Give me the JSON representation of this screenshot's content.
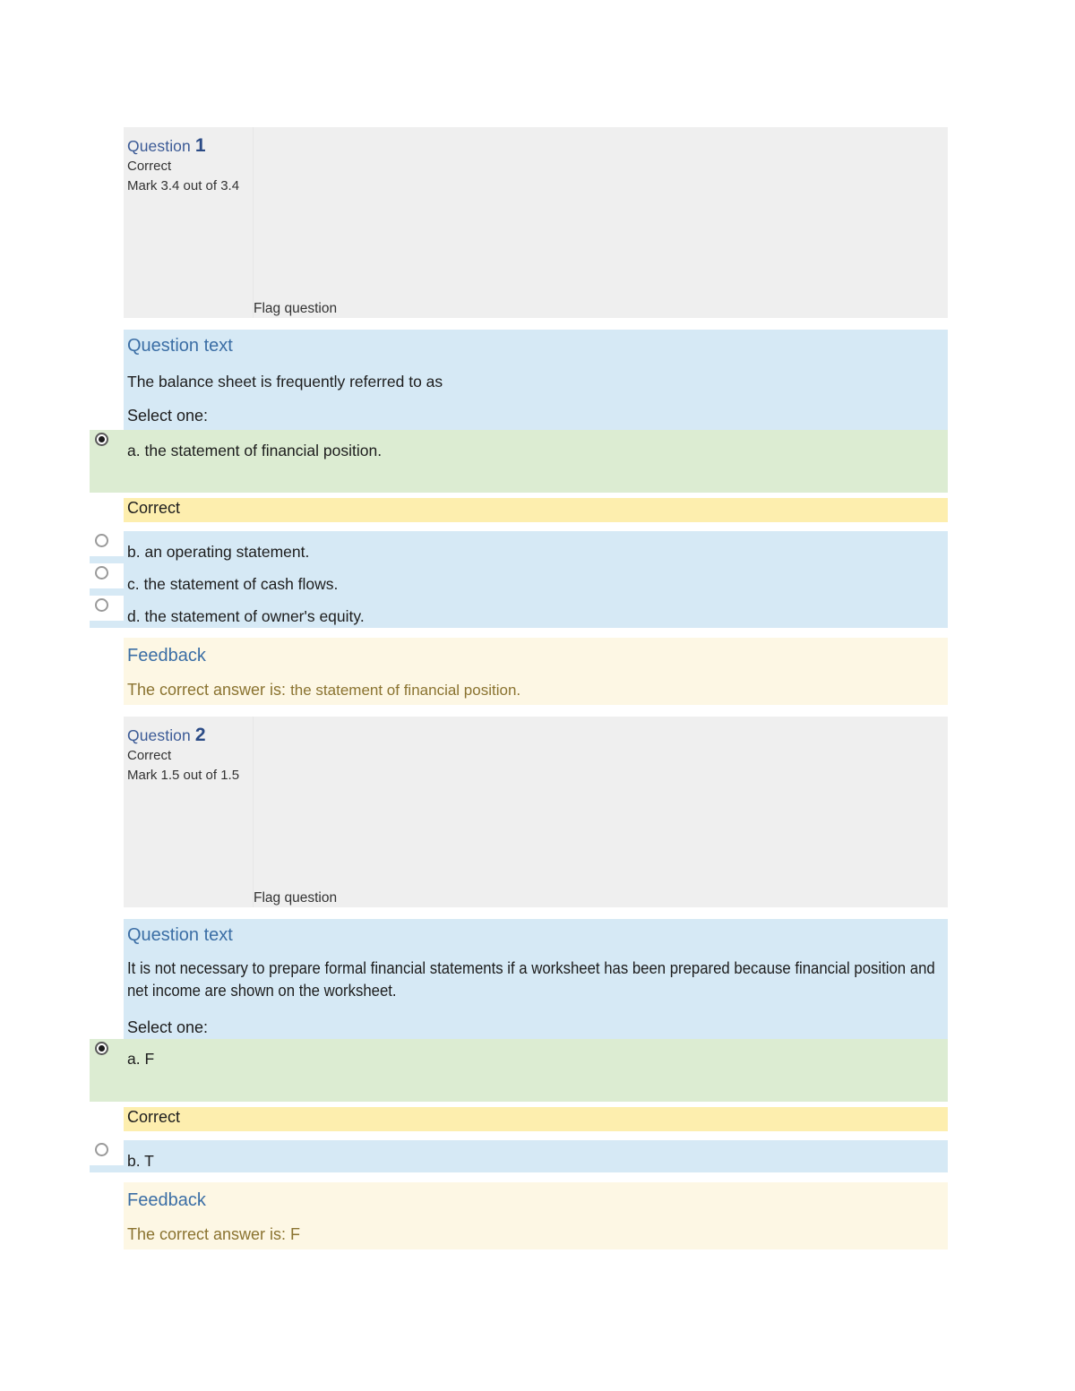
{
  "colors": {
    "header_bg": "#efefef",
    "question_bg": "#d6e9f5",
    "correct_option_bg": "#dcecd2",
    "correct_band_bg": "#fdeeae",
    "feedback_bg": "#fdf7e4",
    "heading_blue": "#3b6ea5",
    "feedback_text": "#8a7330"
  },
  "questions": [
    {
      "number_label": "Question",
      "number": "1",
      "state": "Correct",
      "mark": "Mark 3.4 out of 3.4",
      "flag_label": "Flag question",
      "question_text_title": "Question text",
      "body": "The balance sheet is frequently referred to as",
      "select_one": "Select one:",
      "options": [
        {
          "letter": "a.",
          "text": "the statement of financial position.",
          "selected": true,
          "correct": true
        },
        {
          "letter": "b.",
          "text": "an operating statement.",
          "selected": false,
          "correct": false
        },
        {
          "letter": "c.",
          "text": "the statement of cash flows.",
          "selected": false,
          "correct": false
        },
        {
          "letter": "d.",
          "text": "the statement of owner's equity.",
          "selected": false,
          "correct": false
        }
      ],
      "correct_band": "Correct",
      "feedback_title": "Feedback",
      "feedback_lead": "The correct answer is:",
      "feedback_answer": "the statement of financial position."
    },
    {
      "number_label": "Question",
      "number": "2",
      "state": "Correct",
      "mark": "Mark 1.5 out of 1.5",
      "flag_label": "Flag question",
      "question_text_title": "Question text",
      "body": "It is not necessary to prepare formal financial statements if a worksheet has been prepared because financial position and net income are shown on the worksheet.",
      "select_one": "Select one:",
      "options": [
        {
          "letter": "a.",
          "text": "F",
          "selected": true,
          "correct": true
        },
        {
          "letter": "b.",
          "text": "T",
          "selected": false,
          "correct": false
        }
      ],
      "correct_band": "Correct",
      "feedback_title": "Feedback",
      "feedback_lead": "The correct answer is: F",
      "feedback_answer": ""
    }
  ]
}
